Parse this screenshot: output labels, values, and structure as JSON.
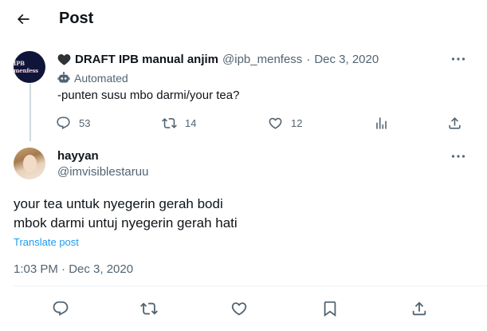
{
  "header": {
    "title": "Post"
  },
  "quoted_post": {
    "avatar_text": "IPB menfess",
    "display_name": "DRAFT IPB manual anjim",
    "handle": "@ipb_menfess",
    "separator": "·",
    "date": "Dec 3, 2020",
    "automated_label": "Automated",
    "text": "-punten susu mbo darmi/your tea?",
    "stats": {
      "replies": "53",
      "reposts": "14",
      "likes": "12"
    }
  },
  "reply_post": {
    "display_name": "hayyan",
    "handle": "@imvisiblestaruu",
    "text_lines": [
      "your tea untuk nyegerin gerah bodi",
      "mbok darmi untuj nyegerin gerah hati"
    ],
    "translate_label": "Translate post",
    "timestamp": "1:03 PM · Dec 3, 2020"
  },
  "colors": {
    "text_primary": "#0f1419",
    "text_secondary": "#536471",
    "link": "#1d9bf0",
    "divider": "#eff3f4"
  }
}
